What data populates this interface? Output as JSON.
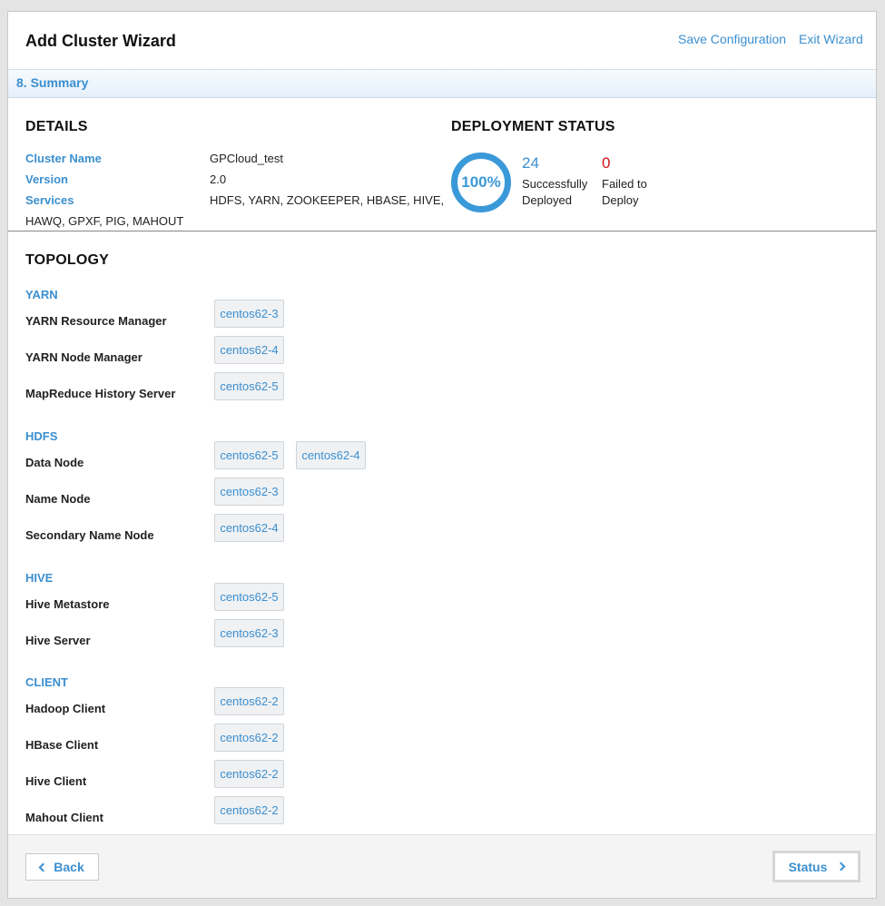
{
  "header": {
    "title": "Add Cluster Wizard",
    "save_link": "Save Configuration",
    "exit_link": "Exit Wizard"
  },
  "step": {
    "label": "8. Summary"
  },
  "details": {
    "heading": "DETAILS",
    "cluster_name_label": "Cluster Name",
    "cluster_name_value": "GPCloud_test",
    "version_label": "Version",
    "version_value": "2.0",
    "services_label": "Services",
    "services_value_line1": "HDFS, YARN, ZOOKEEPER, HBASE, HIVE,",
    "services_value_line2": "HAWQ, GPXF, PIG, MAHOUT"
  },
  "deployment": {
    "heading": "DEPLOYMENT STATUS",
    "progress_percent": 100,
    "progress_label": "100%",
    "success_count": "24",
    "success_label_line1": "Successfully",
    "success_label_line2": "Deployed",
    "failed_count": "0",
    "failed_label_line1": "Failed to",
    "failed_label_line2": "Deploy",
    "success_color": "#3a99d8",
    "failed_color": "#d0121b"
  },
  "topology": {
    "heading": "TOPOLOGY",
    "yarn": {
      "label": "YARN",
      "resource_manager": {
        "role": "YARN Resource Manager",
        "hosts": [
          "centos62-3"
        ]
      },
      "node_manager": {
        "role": "YARN Node Manager",
        "hosts": [
          "centos62-4"
        ]
      },
      "history_server": {
        "role": "MapReduce History Server",
        "hosts": [
          "centos62-5"
        ]
      }
    },
    "hdfs": {
      "label": "HDFS",
      "data_node": {
        "role": "Data Node",
        "hosts": [
          "centos62-5",
          "centos62-4"
        ]
      },
      "name_node": {
        "role": "Name Node",
        "hosts": [
          "centos62-3"
        ]
      },
      "secondary_name_node": {
        "role": "Secondary Name Node",
        "hosts": [
          "centos62-4"
        ]
      }
    },
    "hive": {
      "label": "HIVE",
      "metastore": {
        "role": "Hive Metastore",
        "hosts": [
          "centos62-5"
        ]
      },
      "server": {
        "role": "Hive Server",
        "hosts": [
          "centos62-3"
        ]
      }
    },
    "client": {
      "label": "CLIENT",
      "hadoop_client": {
        "role": "Hadoop Client",
        "hosts": [
          "centos62-2"
        ]
      },
      "hbase_client": {
        "role": "HBase Client",
        "hosts": [
          "centos62-2"
        ]
      },
      "hive_client": {
        "role": "Hive Client",
        "hosts": [
          "centos62-2"
        ]
      },
      "mahout_client": {
        "role": "Mahout Client",
        "hosts": [
          "centos62-2"
        ]
      }
    }
  },
  "footer": {
    "back_label": "Back",
    "status_label": "Status"
  },
  "colors": {
    "accent": "#3b8fd0",
    "failed": "#d0121b"
  },
  "icons": [
    "chevron-left-icon",
    "chevron-right-icon"
  ]
}
